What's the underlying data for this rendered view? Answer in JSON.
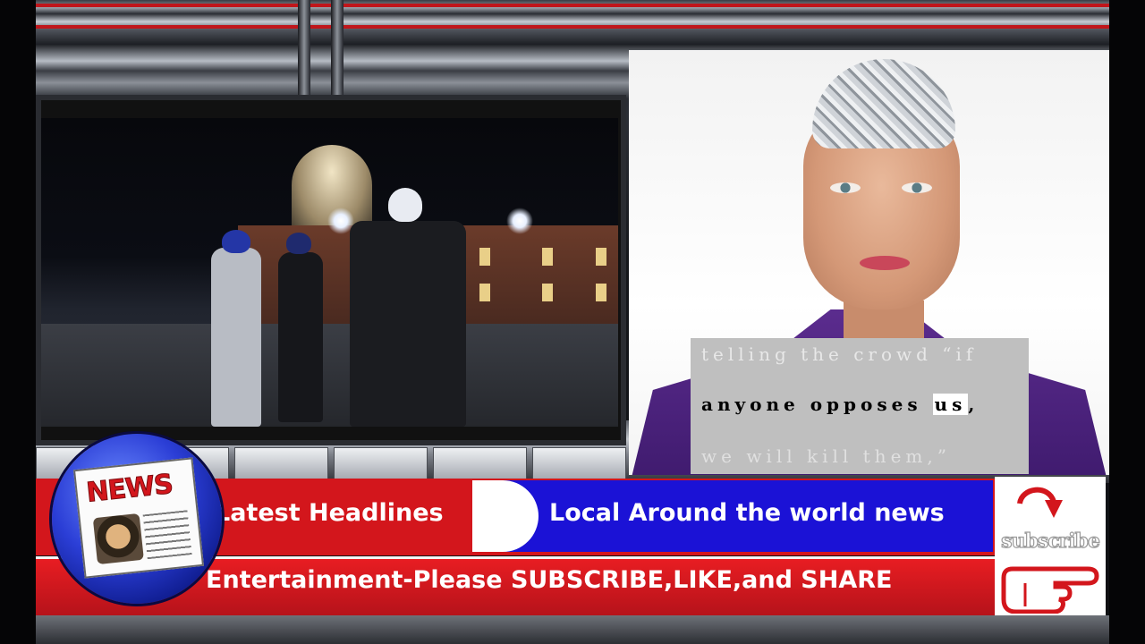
{
  "caption": {
    "line1": "telling the crowd “if",
    "line2_pre": "anyone opposes ",
    "line2_hl": "us",
    "line2_post": ",",
    "line3": "we will kill them,”"
  },
  "lower_third": {
    "left_headline": "Latest Headlines",
    "right_headline": "Local Around the world news",
    "ticker": "Entertainment-Please SUBSCRIBE,LIKE,and SHARE"
  },
  "logo": {
    "word": "NEWS"
  },
  "subscribe": {
    "label": "subscribe"
  },
  "colors": {
    "red": "#d3161c",
    "blue": "#1b12d6",
    "purple": "#5b2c8e"
  },
  "icons": [
    "curved-arrow-icon",
    "pointing-hand-icon",
    "newspaper-icon"
  ]
}
